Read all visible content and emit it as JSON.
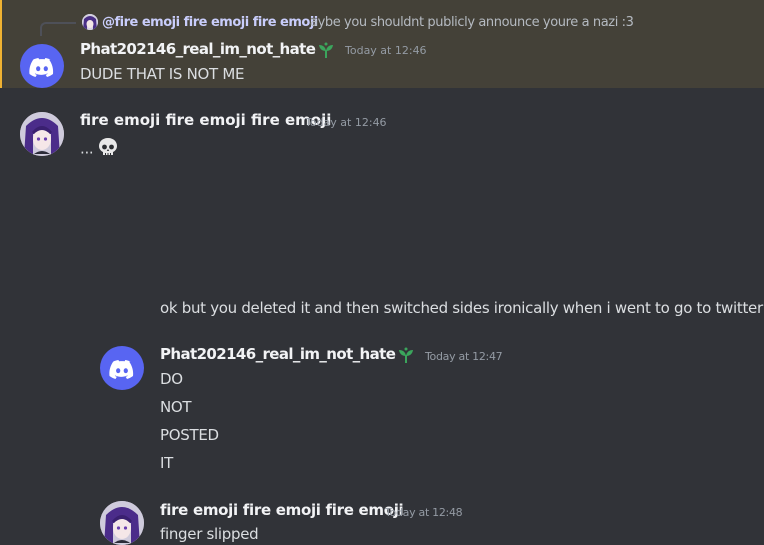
{
  "colors": {
    "background": "#313338",
    "highlight": "#444138",
    "mention_bar": "#f0b232",
    "discord_blurple": "#5865f2",
    "badge_green": "#3ba55c"
  },
  "reply": {
    "author": "@fire emoji fire emoji fire emoji",
    "text": "aybe you shouldnt publicly announce youre a nazi :3"
  },
  "messages": [
    {
      "author": "Phat202146_real_im_not_hate",
      "badge_icon": "sprout-icon",
      "time": "Today at 12:46",
      "lines": [
        "DUDE THAT IS NOT ME"
      ]
    },
    {
      "author": "fire emoji fire emoji fire emoji",
      "time": "Today at 12:46",
      "lines": [
        "...",
        "ok but you deleted it and then switched sides ironically when i went to go to twitter"
      ],
      "emoji": "skull-icon"
    },
    {
      "author": "Phat202146_real_im_not_hate",
      "badge_icon": "sprout-icon",
      "time": "Today at 12:47",
      "lines": [
        "DO",
        "NOT",
        "POSTED",
        "IT"
      ]
    },
    {
      "author": "fire emoji fire emoji fire emoji",
      "time": "Today at 12:48",
      "lines": [
        "finger slipped"
      ]
    }
  ]
}
